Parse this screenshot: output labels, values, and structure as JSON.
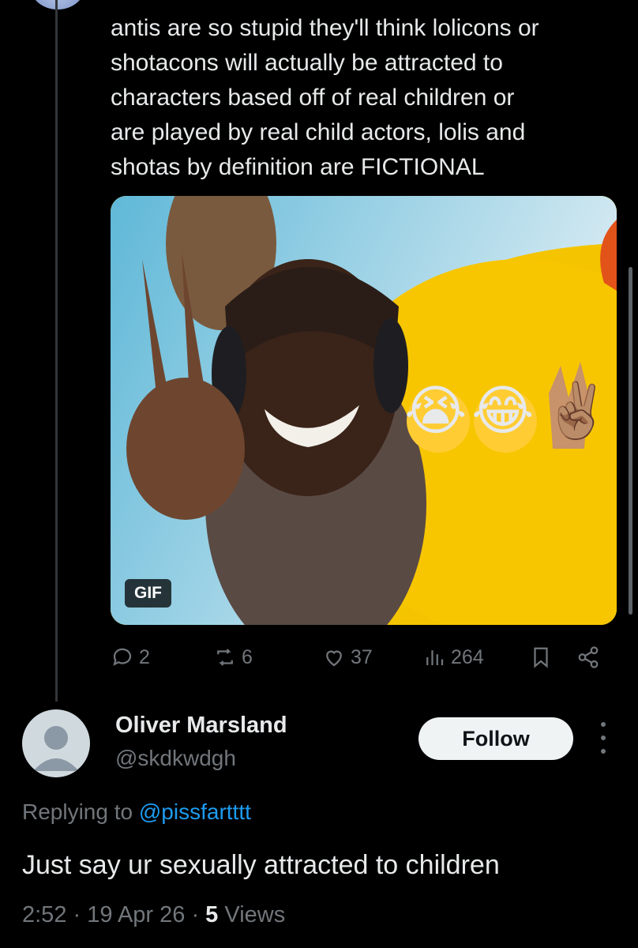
{
  "tweet": {
    "text": "antis are so stupid they'll think lolicons or\nshotacons will actually be attracted to\ncharacters based off of real children or\nare played by real child actors, lolis and\nshotas by definition are FICTIONAL",
    "media": {
      "badge": "GIF",
      "emoji": [
        "😭",
        "😂",
        "✌🏽"
      ]
    },
    "stats": {
      "replies": "2",
      "reposts": "6",
      "likes": "37",
      "views": "264"
    }
  },
  "reply": {
    "name": "Oliver Marsland",
    "handle": "@skdkwdgh",
    "follow_label": "Follow",
    "replying_prefix": "Replying to ",
    "replying_to": "@pissfartttt",
    "text": "Just say ur sexually attracted to children",
    "time": "2:52",
    "date": "19 Apr 26",
    "views_count": "5",
    "views_label": "Views"
  },
  "colors": {
    "muted": "#71767b",
    "link": "#1d9bf0",
    "text": "#e7e9ea",
    "background": "#000000"
  }
}
